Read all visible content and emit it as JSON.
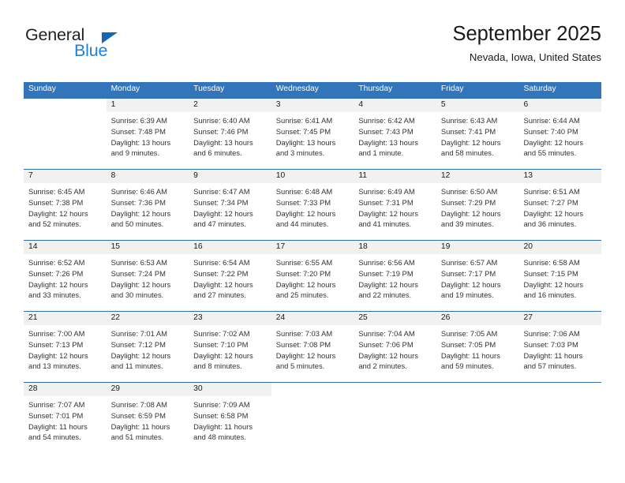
{
  "brand": {
    "name_part1": "General",
    "name_part2": "Blue",
    "triangle_icon": "triangle-icon",
    "accent_color": "#1668b3"
  },
  "header": {
    "title": "September 2025",
    "subtitle": "Nevada, Iowa, United States"
  },
  "calendar": {
    "header_bg": "#3275bb",
    "daynum_bg": "#f1f1f1",
    "weekdays": [
      "Sunday",
      "Monday",
      "Tuesday",
      "Wednesday",
      "Thursday",
      "Friday",
      "Saturday"
    ],
    "weeks": [
      [
        {
          "day": "",
          "lines": []
        },
        {
          "day": "1",
          "lines": [
            "Sunrise: 6:39 AM",
            "Sunset: 7:48 PM",
            "Daylight: 13 hours",
            "and 9 minutes."
          ]
        },
        {
          "day": "2",
          "lines": [
            "Sunrise: 6:40 AM",
            "Sunset: 7:46 PM",
            "Daylight: 13 hours",
            "and 6 minutes."
          ]
        },
        {
          "day": "3",
          "lines": [
            "Sunrise: 6:41 AM",
            "Sunset: 7:45 PM",
            "Daylight: 13 hours",
            "and 3 minutes."
          ]
        },
        {
          "day": "4",
          "lines": [
            "Sunrise: 6:42 AM",
            "Sunset: 7:43 PM",
            "Daylight: 13 hours",
            "and 1 minute."
          ]
        },
        {
          "day": "5",
          "lines": [
            "Sunrise: 6:43 AM",
            "Sunset: 7:41 PM",
            "Daylight: 12 hours",
            "and 58 minutes."
          ]
        },
        {
          "day": "6",
          "lines": [
            "Sunrise: 6:44 AM",
            "Sunset: 7:40 PM",
            "Daylight: 12 hours",
            "and 55 minutes."
          ]
        }
      ],
      [
        {
          "day": "7",
          "lines": [
            "Sunrise: 6:45 AM",
            "Sunset: 7:38 PM",
            "Daylight: 12 hours",
            "and 52 minutes."
          ]
        },
        {
          "day": "8",
          "lines": [
            "Sunrise: 6:46 AM",
            "Sunset: 7:36 PM",
            "Daylight: 12 hours",
            "and 50 minutes."
          ]
        },
        {
          "day": "9",
          "lines": [
            "Sunrise: 6:47 AM",
            "Sunset: 7:34 PM",
            "Daylight: 12 hours",
            "and 47 minutes."
          ]
        },
        {
          "day": "10",
          "lines": [
            "Sunrise: 6:48 AM",
            "Sunset: 7:33 PM",
            "Daylight: 12 hours",
            "and 44 minutes."
          ]
        },
        {
          "day": "11",
          "lines": [
            "Sunrise: 6:49 AM",
            "Sunset: 7:31 PM",
            "Daylight: 12 hours",
            "and 41 minutes."
          ]
        },
        {
          "day": "12",
          "lines": [
            "Sunrise: 6:50 AM",
            "Sunset: 7:29 PM",
            "Daylight: 12 hours",
            "and 39 minutes."
          ]
        },
        {
          "day": "13",
          "lines": [
            "Sunrise: 6:51 AM",
            "Sunset: 7:27 PM",
            "Daylight: 12 hours",
            "and 36 minutes."
          ]
        }
      ],
      [
        {
          "day": "14",
          "lines": [
            "Sunrise: 6:52 AM",
            "Sunset: 7:26 PM",
            "Daylight: 12 hours",
            "and 33 minutes."
          ]
        },
        {
          "day": "15",
          "lines": [
            "Sunrise: 6:53 AM",
            "Sunset: 7:24 PM",
            "Daylight: 12 hours",
            "and 30 minutes."
          ]
        },
        {
          "day": "16",
          "lines": [
            "Sunrise: 6:54 AM",
            "Sunset: 7:22 PM",
            "Daylight: 12 hours",
            "and 27 minutes."
          ]
        },
        {
          "day": "17",
          "lines": [
            "Sunrise: 6:55 AM",
            "Sunset: 7:20 PM",
            "Daylight: 12 hours",
            "and 25 minutes."
          ]
        },
        {
          "day": "18",
          "lines": [
            "Sunrise: 6:56 AM",
            "Sunset: 7:19 PM",
            "Daylight: 12 hours",
            "and 22 minutes."
          ]
        },
        {
          "day": "19",
          "lines": [
            "Sunrise: 6:57 AM",
            "Sunset: 7:17 PM",
            "Daylight: 12 hours",
            "and 19 minutes."
          ]
        },
        {
          "day": "20",
          "lines": [
            "Sunrise: 6:58 AM",
            "Sunset: 7:15 PM",
            "Daylight: 12 hours",
            "and 16 minutes."
          ]
        }
      ],
      [
        {
          "day": "21",
          "lines": [
            "Sunrise: 7:00 AM",
            "Sunset: 7:13 PM",
            "Daylight: 12 hours",
            "and 13 minutes."
          ]
        },
        {
          "day": "22",
          "lines": [
            "Sunrise: 7:01 AM",
            "Sunset: 7:12 PM",
            "Daylight: 12 hours",
            "and 11 minutes."
          ]
        },
        {
          "day": "23",
          "lines": [
            "Sunrise: 7:02 AM",
            "Sunset: 7:10 PM",
            "Daylight: 12 hours",
            "and 8 minutes."
          ]
        },
        {
          "day": "24",
          "lines": [
            "Sunrise: 7:03 AM",
            "Sunset: 7:08 PM",
            "Daylight: 12 hours",
            "and 5 minutes."
          ]
        },
        {
          "day": "25",
          "lines": [
            "Sunrise: 7:04 AM",
            "Sunset: 7:06 PM",
            "Daylight: 12 hours",
            "and 2 minutes."
          ]
        },
        {
          "day": "26",
          "lines": [
            "Sunrise: 7:05 AM",
            "Sunset: 7:05 PM",
            "Daylight: 11 hours",
            "and 59 minutes."
          ]
        },
        {
          "day": "27",
          "lines": [
            "Sunrise: 7:06 AM",
            "Sunset: 7:03 PM",
            "Daylight: 11 hours",
            "and 57 minutes."
          ]
        }
      ],
      [
        {
          "day": "28",
          "lines": [
            "Sunrise: 7:07 AM",
            "Sunset: 7:01 PM",
            "Daylight: 11 hours",
            "and 54 minutes."
          ]
        },
        {
          "day": "29",
          "lines": [
            "Sunrise: 7:08 AM",
            "Sunset: 6:59 PM",
            "Daylight: 11 hours",
            "and 51 minutes."
          ]
        },
        {
          "day": "30",
          "lines": [
            "Sunrise: 7:09 AM",
            "Sunset: 6:58 PM",
            "Daylight: 11 hours",
            "and 48 minutes."
          ]
        },
        {
          "day": "",
          "lines": []
        },
        {
          "day": "",
          "lines": []
        },
        {
          "day": "",
          "lines": []
        },
        {
          "day": "",
          "lines": []
        }
      ]
    ]
  }
}
